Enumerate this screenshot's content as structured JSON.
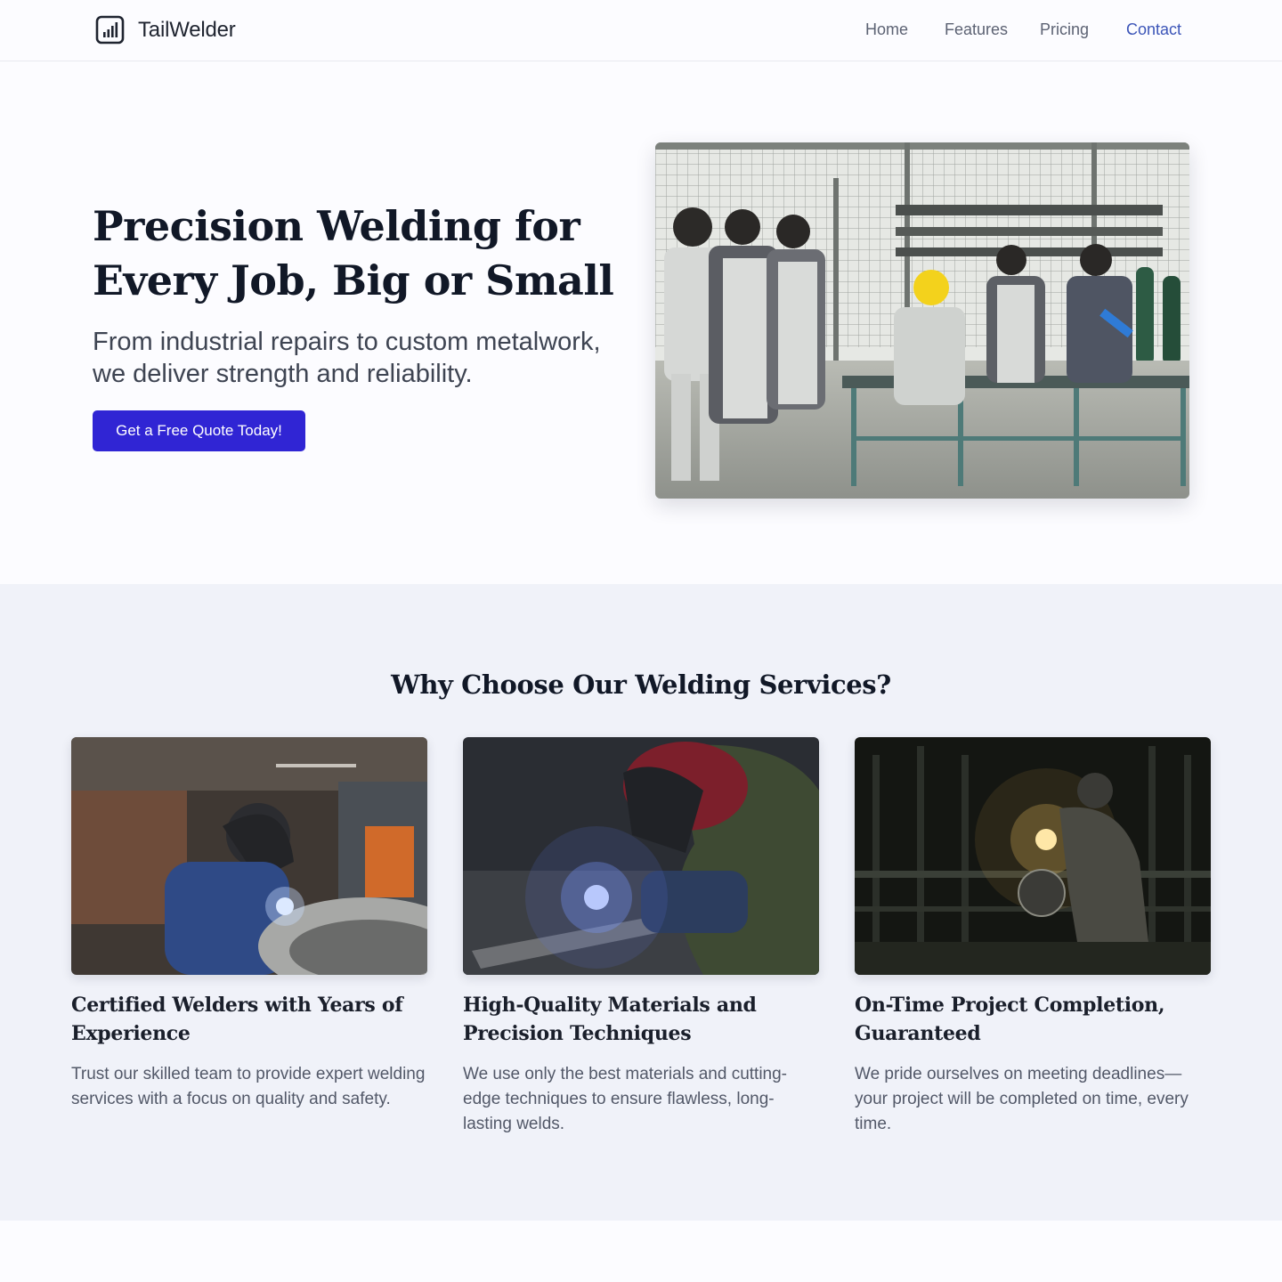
{
  "header": {
    "brand": "TailWelder",
    "brand_icon": "bar-chart-icon",
    "nav": [
      {
        "label": "Home",
        "active": false
      },
      {
        "label": "Features",
        "active": false
      },
      {
        "label": "Pricing",
        "active": false
      },
      {
        "label": "Contact",
        "active": true
      }
    ]
  },
  "hero": {
    "title_line1": "Precision Welding for",
    "title_line2": "Every Job, Big or Small",
    "subtitle_line1": "From industrial repairs to custom metalwork,",
    "subtitle_line2": "we deliver strength and reliability.",
    "cta_label": "Get a Free Quote Today!"
  },
  "features": {
    "title": "Why Choose Our Welding Services?",
    "cards": [
      {
        "title": "Certified Welders with Years of Experience",
        "text": "Trust our skilled team to provide expert welding services with a focus on quality and safety."
      },
      {
        "title": "High-Quality Materials and Precision Techniques",
        "text": "We use only the best materials and cutting-edge techniques to ensure flawless, long-lasting welds."
      },
      {
        "title": "On-Time Project Completion, Guaranteed",
        "text": "We pride ourselves on meeting deadlines—your project will be completed on time, every time."
      }
    ]
  },
  "colors": {
    "accent": "#3025d4",
    "nav_active": "#3c55b8",
    "section_bg": "#f0f2f9",
    "page_bg": "#fcfcff"
  }
}
